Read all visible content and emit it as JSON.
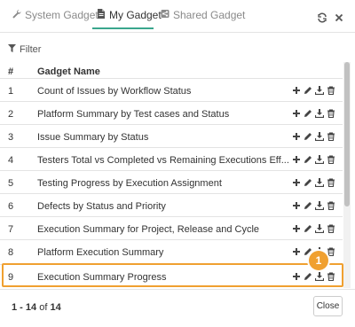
{
  "tabs": [
    {
      "label": "System Gadget",
      "icon": "wrench-icon"
    },
    {
      "label": "My Gadget",
      "icon": "document-icon"
    },
    {
      "label": "Shared Gadget",
      "icon": "share-icon"
    }
  ],
  "header_icons": [
    "refresh-icon",
    "close-icon"
  ],
  "filter": {
    "label": "Filter",
    "icon": "funnel-icon"
  },
  "table": {
    "columns": [
      "#",
      "Gadget Name"
    ],
    "rows": [
      {
        "num": "1",
        "name": "Count of Issues by Workflow Status"
      },
      {
        "num": "2",
        "name": "Platform Summary by Test cases and Status"
      },
      {
        "num": "3",
        "name": "Issue Summary by Status"
      },
      {
        "num": "4",
        "name": "Testers Total vs Completed vs Remaining Executions Eff..."
      },
      {
        "num": "5",
        "name": "Testing Progress by Execution Assignment"
      },
      {
        "num": "6",
        "name": "Defects by Status and Priority"
      },
      {
        "num": "7",
        "name": "Execution Summary for Project, Release and Cycle"
      },
      {
        "num": "8",
        "name": "Platform Execution Summary"
      },
      {
        "num": "9",
        "name": "Execution Summary Progress"
      }
    ],
    "row_actions": [
      "plus-icon",
      "pencil-icon",
      "download-icon",
      "trash-icon"
    ]
  },
  "highlight_badge": "1",
  "pager": {
    "range": "1 - 14",
    "of": "of",
    "total": "14"
  },
  "close_button": "Close",
  "colors": {
    "accent": "#3aa68d",
    "highlight": "#f0a030"
  }
}
